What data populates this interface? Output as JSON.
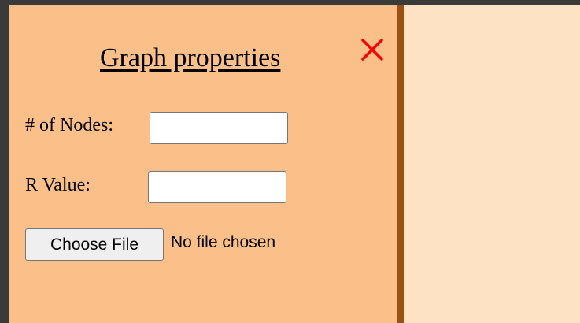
{
  "panel": {
    "title": "Graph properties",
    "close_icon": "close-icon",
    "close_color": "#ff0000",
    "background_color": "#fbbf8a",
    "divider_color": "#99520f",
    "canvas_color": "#fde2c4"
  },
  "form": {
    "nodes_label": "# of Nodes:",
    "nodes_value": "",
    "r_label": "R Value:",
    "r_value": "",
    "file_button_label": "Choose File",
    "file_status": "No file chosen"
  }
}
